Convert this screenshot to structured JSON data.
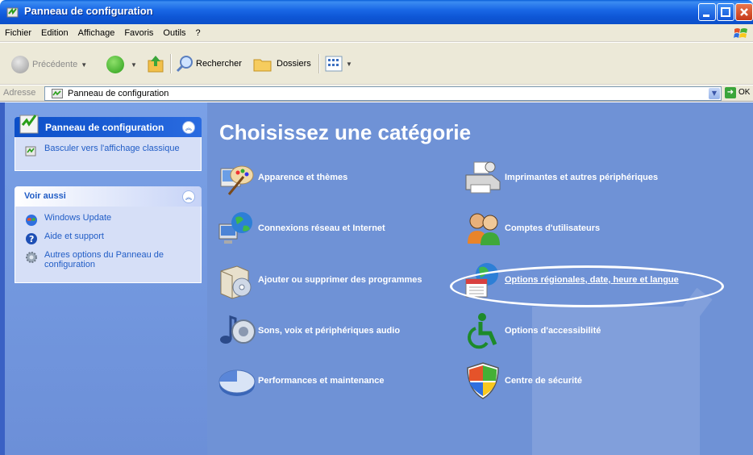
{
  "window": {
    "title": "Panneau de configuration"
  },
  "menu": [
    "Fichier",
    "Edition",
    "Affichage",
    "Favoris",
    "Outils",
    "?"
  ],
  "toolbar": {
    "back": "Précédente",
    "search": "Rechercher",
    "folders": "Dossiers"
  },
  "address": {
    "label": "Adresse",
    "value": "Panneau de configuration",
    "go": "OK"
  },
  "leftpane": {
    "control_panel": {
      "title": "Panneau de configuration",
      "tasks": [
        {
          "label": "Basculer vers l'affichage classique",
          "icon": "switch-view-icon"
        }
      ]
    },
    "see_also": {
      "title": "Voir aussi",
      "links": [
        {
          "label": "Windows Update",
          "icon": "windows-update-icon"
        },
        {
          "label": "Aide et support",
          "icon": "help-icon"
        },
        {
          "label": "Autres options du Panneau de configuration",
          "icon": "gear-icon"
        }
      ]
    }
  },
  "main": {
    "heading": "Choisissez une catégorie",
    "categories": [
      {
        "label": "Apparence et thèmes",
        "icon": "appearance-icon"
      },
      {
        "label": "Imprimantes et autres périphériques",
        "icon": "printer-icon"
      },
      {
        "label": "Connexions réseau et Internet",
        "icon": "network-icon"
      },
      {
        "label": "Comptes d'utilisateurs",
        "icon": "users-icon"
      },
      {
        "label": "Ajouter ou supprimer des programmes",
        "icon": "programs-icon"
      },
      {
        "label": "Options régionales, date, heure et langue",
        "icon": "regional-icon"
      },
      {
        "label": "Sons, voix et périphériques audio",
        "icon": "sound-icon"
      },
      {
        "label": "Options d'accessibilité",
        "icon": "accessibility-icon"
      },
      {
        "label": "Performances et maintenance",
        "icon": "performance-icon"
      },
      {
        "label": "Centre de sécurité",
        "icon": "security-shield-icon"
      }
    ]
  },
  "colors": {
    "titlebar": "#0e56d6",
    "content_bg": "#6f92d6",
    "link": "#215dc6"
  }
}
